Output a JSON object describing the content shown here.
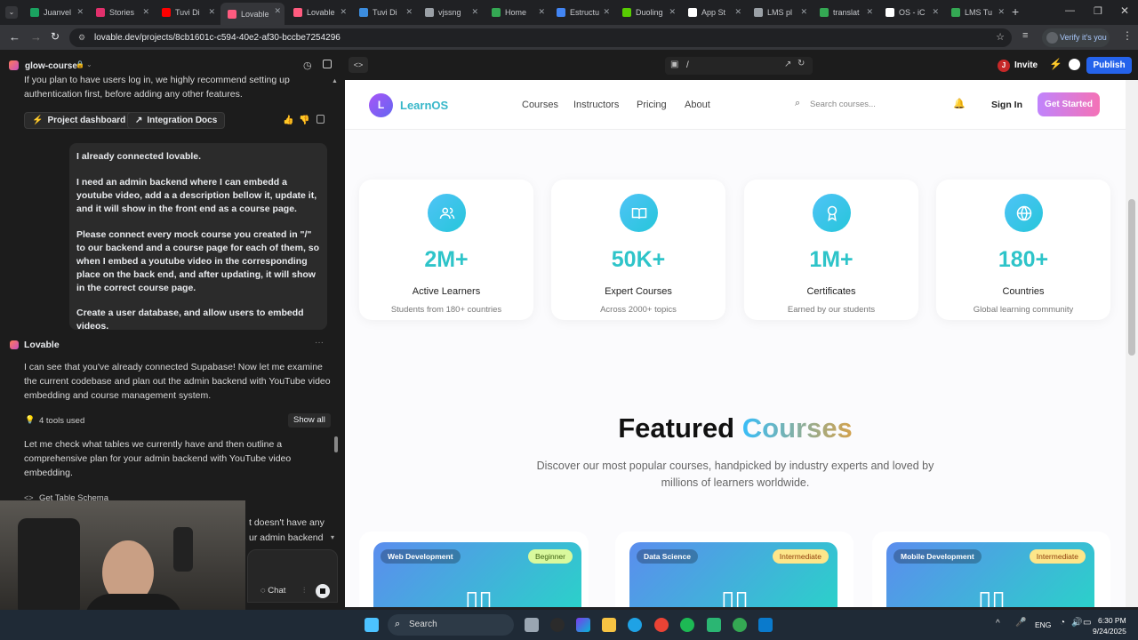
{
  "browser": {
    "tabs": [
      {
        "label": "Juanvel",
        "color": "#1aa260"
      },
      {
        "label": "Stories",
        "color": "#e1306c"
      },
      {
        "label": "Tuvi Di",
        "color": "#ff0000"
      },
      {
        "label": "Lovable",
        "color": "#ff5b7f",
        "active": true
      },
      {
        "label": "Lovable",
        "color": "#ff5b7f"
      },
      {
        "label": "Tuvi Di",
        "color": "#3c8dde"
      },
      {
        "label": "vjssng",
        "color": "#9aa0a6"
      },
      {
        "label": "Home",
        "color": "#34a853"
      },
      {
        "label": "Estructu",
        "color": "#4285f4"
      },
      {
        "label": "Duoling",
        "color": "#58cc02"
      },
      {
        "label": "App St",
        "color": "#ffffff"
      },
      {
        "label": "LMS pl",
        "color": "#9aa0a6"
      },
      {
        "label": "translat",
        "color": "#34a853"
      },
      {
        "label": "OS - iC",
        "color": "#ffffff"
      },
      {
        "label": "LMS Tu",
        "color": "#34a853"
      }
    ],
    "new_tab": "+",
    "url": "lovable.dev/projects/8cb1601c-c594-40e2-af30-bccbe7254296",
    "profile_label": "Verify it's you"
  },
  "left_panel": {
    "project_name": "glow-course",
    "intro_text": "If you plan to have users log in, we highly recommend setting up authentication first, before adding any other features.",
    "btn_dashboard": "Project dashboard",
    "btn_docs": "Integration Docs",
    "user_msg_1": "I already connected lovable.",
    "user_msg_2": "I need an admin backend where I can embedd a youtube video, add a a description bellow it, update it, and it will show in the front end as a course page.",
    "user_msg_3": "Please connect every mock course you created in \"/\" to our backend and a course page for each of them, so when I embed a youtube video in the corresponding place on the back end, and after updating, it will show in the correct course page.",
    "user_msg_4": "Create a user database, and allow users to embedd videos.",
    "ai_name": "Lovable",
    "ai_msg_1": "I can see that you've already connected Supabase! Now let me examine the current codebase and plan out the admin backend with YouTube video embedding and course management system.",
    "tools_used": "4 tools used",
    "show_all": "Show all",
    "ai_msg_2": "Let me check what tables we currently have and then outline a comprehensive plan for your admin backend with YouTube video embedding.",
    "get_table_schema": "Get Table Schema",
    "partial_1": "t doesn't have any",
    "partial_2": "ur admin backend",
    "chat_label": "Chat"
  },
  "preview_bar": {
    "path": "/",
    "invite": "Invite",
    "publish": "Publish",
    "avatar_letter": "J"
  },
  "site": {
    "logo_letter": "L",
    "logo_text": "LearnOS",
    "nav": [
      "Courses",
      "Instructors",
      "Pricing",
      "About"
    ],
    "search_placeholder": "Search courses...",
    "sign_in": "Sign In",
    "get_started": "Get Started",
    "stats": [
      {
        "value": "2M+",
        "label": "Active Learners",
        "sub": "Students from 180+ countries",
        "icon": "users-icon"
      },
      {
        "value": "50K+",
        "label": "Expert Courses",
        "sub": "Across 2000+ topics",
        "icon": "book-icon"
      },
      {
        "value": "1M+",
        "label": "Certificates",
        "sub": "Earned by our students",
        "icon": "award-icon"
      },
      {
        "value": "180+",
        "label": "Countries",
        "sub": "Global learning community",
        "icon": "globe-icon"
      }
    ],
    "featured_word_1": "Featured",
    "featured_word_2": "Courses",
    "featured_desc_1": "Discover our most popular courses, handpicked by industry experts and loved by",
    "featured_desc_2": "millions of learners worldwide.",
    "courses": [
      {
        "category": "Web Development",
        "level": "Beginner"
      },
      {
        "category": "Data Science",
        "level": "Intermediate"
      },
      {
        "category": "Mobile Development",
        "level": "Intermediate"
      }
    ]
  },
  "taskbar": {
    "search": "Search",
    "lang": "ENG",
    "time": "6:30 PM",
    "date": "9/24/2025"
  }
}
